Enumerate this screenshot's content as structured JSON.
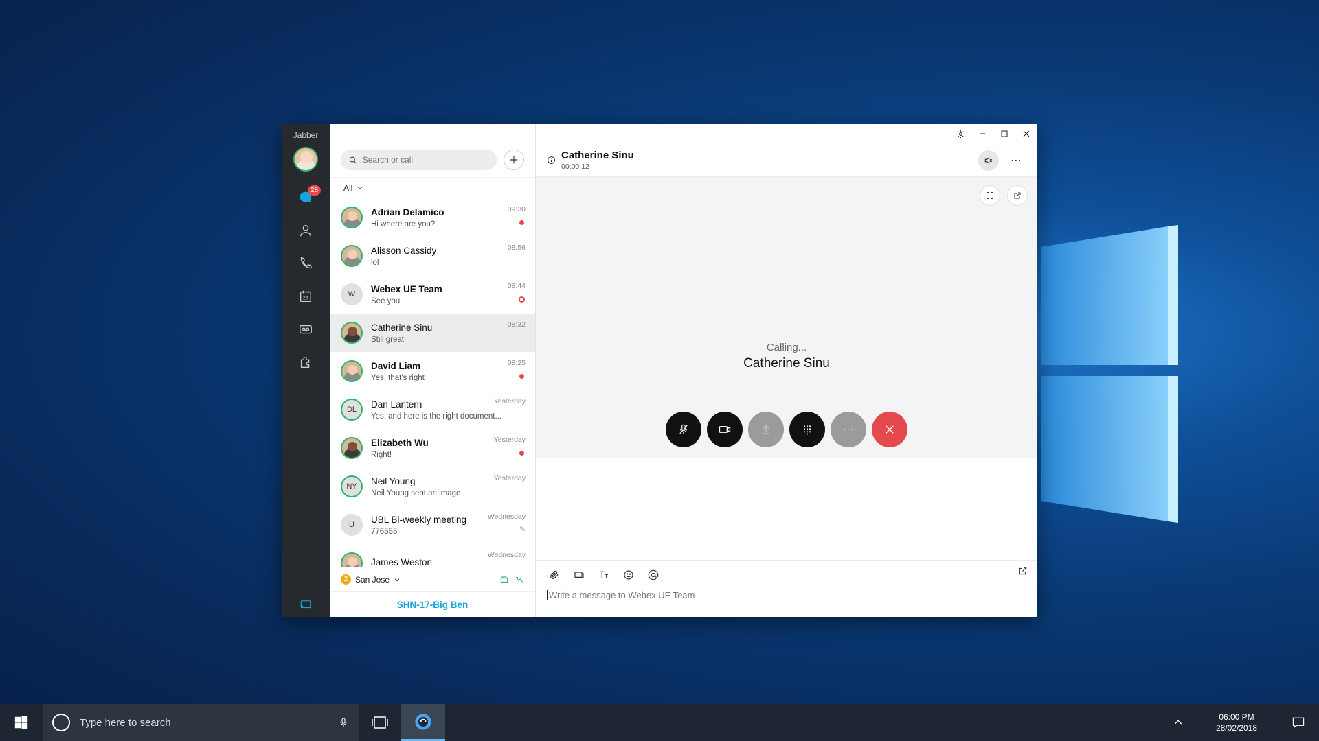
{
  "app": {
    "brand": "Jabber",
    "rail": {
      "messages_badge": "28"
    },
    "search": {
      "placeholder": "Search or call"
    },
    "filter": {
      "label": "All"
    },
    "conversations": [
      {
        "name": "Adrian Delamico",
        "snippet": "Hi where are you?",
        "time": "09:30",
        "bold": true,
        "indicator": "dot",
        "avatar": "photo"
      },
      {
        "name": "Alisson Cassidy",
        "snippet": "lol",
        "time": "08:56",
        "bold": false,
        "indicator": "",
        "avatar": "photo"
      },
      {
        "name": "Webex UE Team",
        "snippet": "See you",
        "time": "08:44",
        "bold": true,
        "indicator": "ring",
        "avatar": "W"
      },
      {
        "name": "Catherine Sinu",
        "snippet": "Still great",
        "time": "08:32",
        "bold": false,
        "indicator": "",
        "avatar": "photo-dark",
        "active": true
      },
      {
        "name": "David Liam",
        "snippet": "Yes, that's right",
        "time": "08:25",
        "bold": true,
        "indicator": "dot",
        "avatar": "photo"
      },
      {
        "name": "Dan Lantern",
        "snippet": "Yes, and here is the right document...",
        "time": "Yesterday",
        "bold": false,
        "indicator": "",
        "avatar": "DL"
      },
      {
        "name": "Elizabeth Wu",
        "snippet": "Right!",
        "time": "Yesterday",
        "bold": true,
        "indicator": "dot",
        "avatar": "photo-dark"
      },
      {
        "name": "Neil Young",
        "snippet": "Neil Young sent an image",
        "time": "Yesterday",
        "bold": false,
        "indicator": "",
        "avatar": "NY"
      },
      {
        "name": "UBL Bi-weekly meeting",
        "snippet": "776555",
        "time": "Wednesday",
        "bold": false,
        "indicator": "pen",
        "avatar": "U"
      },
      {
        "name": "James Weston",
        "snippet": "",
        "time": "Wednesday",
        "bold": false,
        "indicator": "",
        "avatar": "photo"
      }
    ],
    "location": {
      "badge": "2",
      "label": "San Jose"
    },
    "device": {
      "label": "SHN-17-Big Ben"
    },
    "call": {
      "contact": "Catherine Sinu",
      "timer": "00:00:12",
      "status": "Calling...",
      "callee": "Catherine Sinu"
    },
    "composer": {
      "placeholder": "Write a message to Webex UE Team"
    }
  },
  "taskbar": {
    "search_placeholder": "Type here to search",
    "time": "06:00 PM",
    "date": "28/02/2018"
  },
  "colors": {
    "accent_green": "#2fb56a",
    "alert_red": "#e5484d",
    "device_blue": "#1aa3d8",
    "rail_dark": "#26292d"
  }
}
